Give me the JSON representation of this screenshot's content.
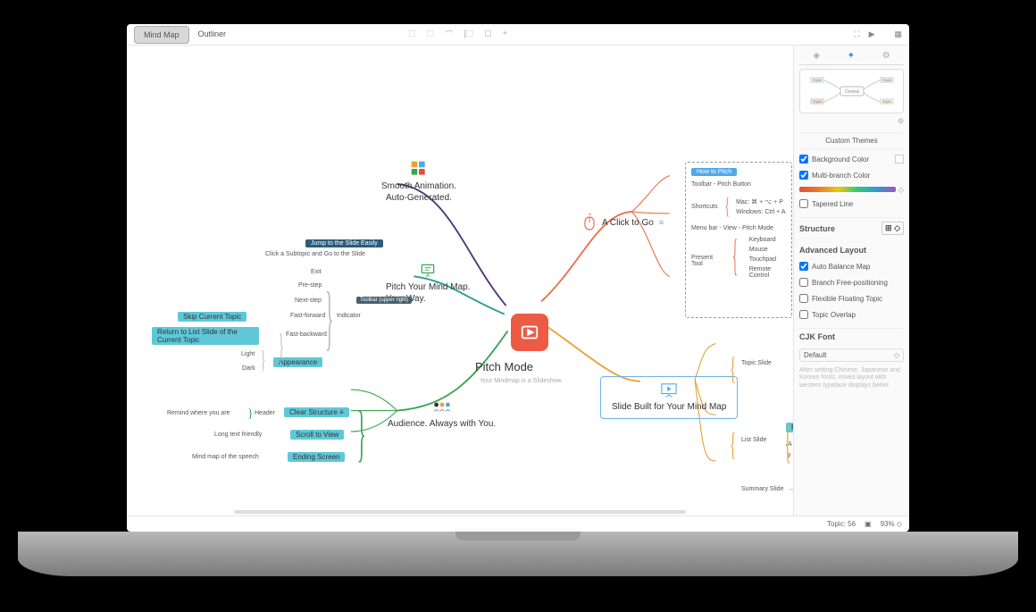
{
  "toolbar": {
    "tab1": "Mind Map",
    "tab2": "Outliner"
  },
  "central": {
    "title": "Pitch Mode",
    "subtitle": "Your Mindmap is a Slideshow"
  },
  "branches": {
    "animation": {
      "title1": "Smooth Animation.",
      "title2": "Auto-Generated."
    },
    "pitch": {
      "title1": "Pitch Your Mind Map.",
      "title2": "Your Way.",
      "jump_tag": "Jump to the Slide Easily",
      "click_sub": "Click a Subtopic and Go to the Slide",
      "indicator": "Indicator",
      "toolbar_note": "Toolbar (upper right)",
      "exit": "Exit",
      "prestep": "Pre-step",
      "nextstep": "Next-step",
      "fastfwd": "Fast-forward",
      "fastbwd": "Fast-backward",
      "light": "Light",
      "dark": "Dark",
      "skip": "Skip Current Topic",
      "return": "Return to List Slide of the Current Topic",
      "appearance": "Appearance"
    },
    "audience": {
      "title": "Audience. Always with You.",
      "header": "Header",
      "remind": "Remind where you are",
      "longtext": "Long text friendly",
      "mindmap": "Mind map of the speech",
      "clear": "Clear Structure",
      "scroll": "Scroll to View",
      "ending": "Ending Screen"
    },
    "click": {
      "title": "A Click to Go",
      "howto": "How to Pitch",
      "toolbar": "Toolbar - Pitch Button",
      "shortcuts": "Shortcuts",
      "mac": "Mac: ⌘ + ⌥ + P",
      "win": "Windows: Ctrl + A",
      "menubar": "Menu bar - View - Pitch Mode",
      "present": "Present Tool",
      "keyboard": "Keyboard",
      "mouse": "Mouse",
      "touchpad": "Touchpad",
      "remote": "Remote Control"
    },
    "slide": {
      "title": "Slide Built for Your Mind Map",
      "topic": "Topic Slide",
      "list": "List Slide",
      "summary": "Summary Slide",
      "p_label": "P",
      "a_label": "A",
      "y_label": "y"
    }
  },
  "panel": {
    "custom_themes": "Custom Themes",
    "bg_color": "Background Color",
    "multi_branch": "Multi-branch Color",
    "tapered": "Tapered Line",
    "structure": "Structure",
    "adv_layout": "Advanced Layout",
    "auto_balance": "Auto Balance Map",
    "branch_free": "Branch Free-positioning",
    "flex_float": "Flexible Floating Topic",
    "topic_overlap": "Topic Overlap",
    "cjk_font": "CJK Font",
    "default": "Default",
    "hint": "After setting Chinese, Japanese and Korean fonts, mixed layout with western typeface displays better.",
    "preview_central": "Central",
    "preview_topic": "Topic"
  },
  "status": {
    "topic": "Topic: 56",
    "zoom": "93%"
  }
}
